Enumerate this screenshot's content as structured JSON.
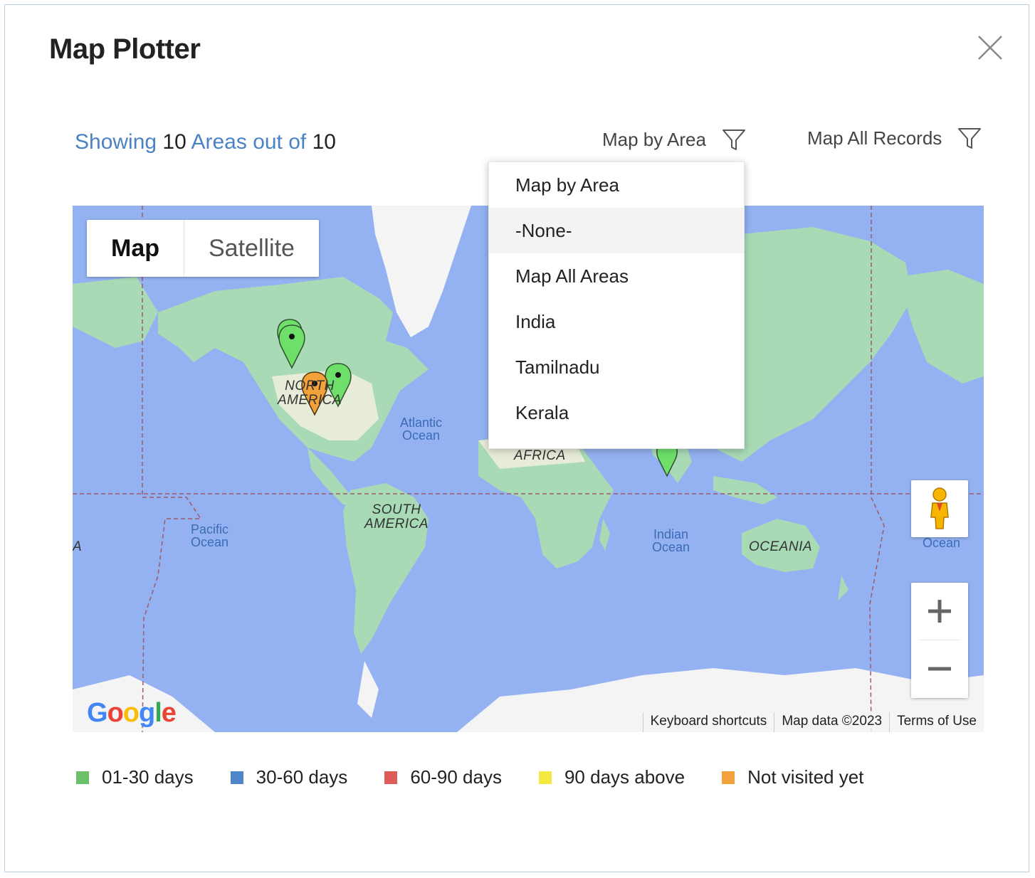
{
  "dialog": {
    "title": "Map Plotter",
    "close_icon": "close-icon"
  },
  "summary": {
    "prefix": "Showing",
    "shown": "10",
    "middle": "Areas out of",
    "total": "10"
  },
  "filters": {
    "area_label": "Map by Area",
    "records_label": "Map All Records",
    "icon": "filter-icon"
  },
  "dropdown": {
    "items": [
      {
        "label": "Map by Area"
      },
      {
        "label": "-None-"
      },
      {
        "label": "Map All Areas"
      },
      {
        "label": "India"
      },
      {
        "label": "Tamilnadu"
      },
      {
        "label": "Kerala"
      }
    ],
    "highlighted": "-None-"
  },
  "map": {
    "type_buttons": {
      "map": "Map",
      "satellite": "Satellite",
      "selected": "Map"
    },
    "labels": {
      "atlantic_1": "Atlantic",
      "atlantic_2": "Ocean",
      "pacific_1": "Pacific",
      "pacific_2": "Ocean",
      "indian_1": "Indian",
      "indian_2": "Ocean",
      "east_ocean": "Ocean",
      "north_america_1": "NORTH",
      "north_america_2": "AMERICA",
      "south_america_1": "SOUTH",
      "south_america_2": "AMERICA",
      "africa": "AFRICA",
      "oceania": "OCEANIA",
      "left_edge": "A"
    },
    "logo": "Google",
    "attribution": {
      "shortcuts": "Keyboard shortcuts",
      "data": "Map data ©2023",
      "terms": "Terms of Use"
    },
    "zoom": {
      "in": "+",
      "out": "−"
    },
    "colors": {
      "water": "#94b2f1",
      "land": "#a8dab5",
      "land_light": "#e8eee0",
      "ice": "#f2f2f2"
    }
  },
  "legend": {
    "items": [
      {
        "label": "01-30 days",
        "color": "#6cc06a"
      },
      {
        "label": "30-60 days",
        "color": "#4f86c9"
      },
      {
        "label": "60-90 days",
        "color": "#de5c57"
      },
      {
        "label": "90 days above",
        "color": "#f3e940"
      },
      {
        "label": "Not visited yet",
        "color": "#f3a13b"
      }
    ]
  }
}
